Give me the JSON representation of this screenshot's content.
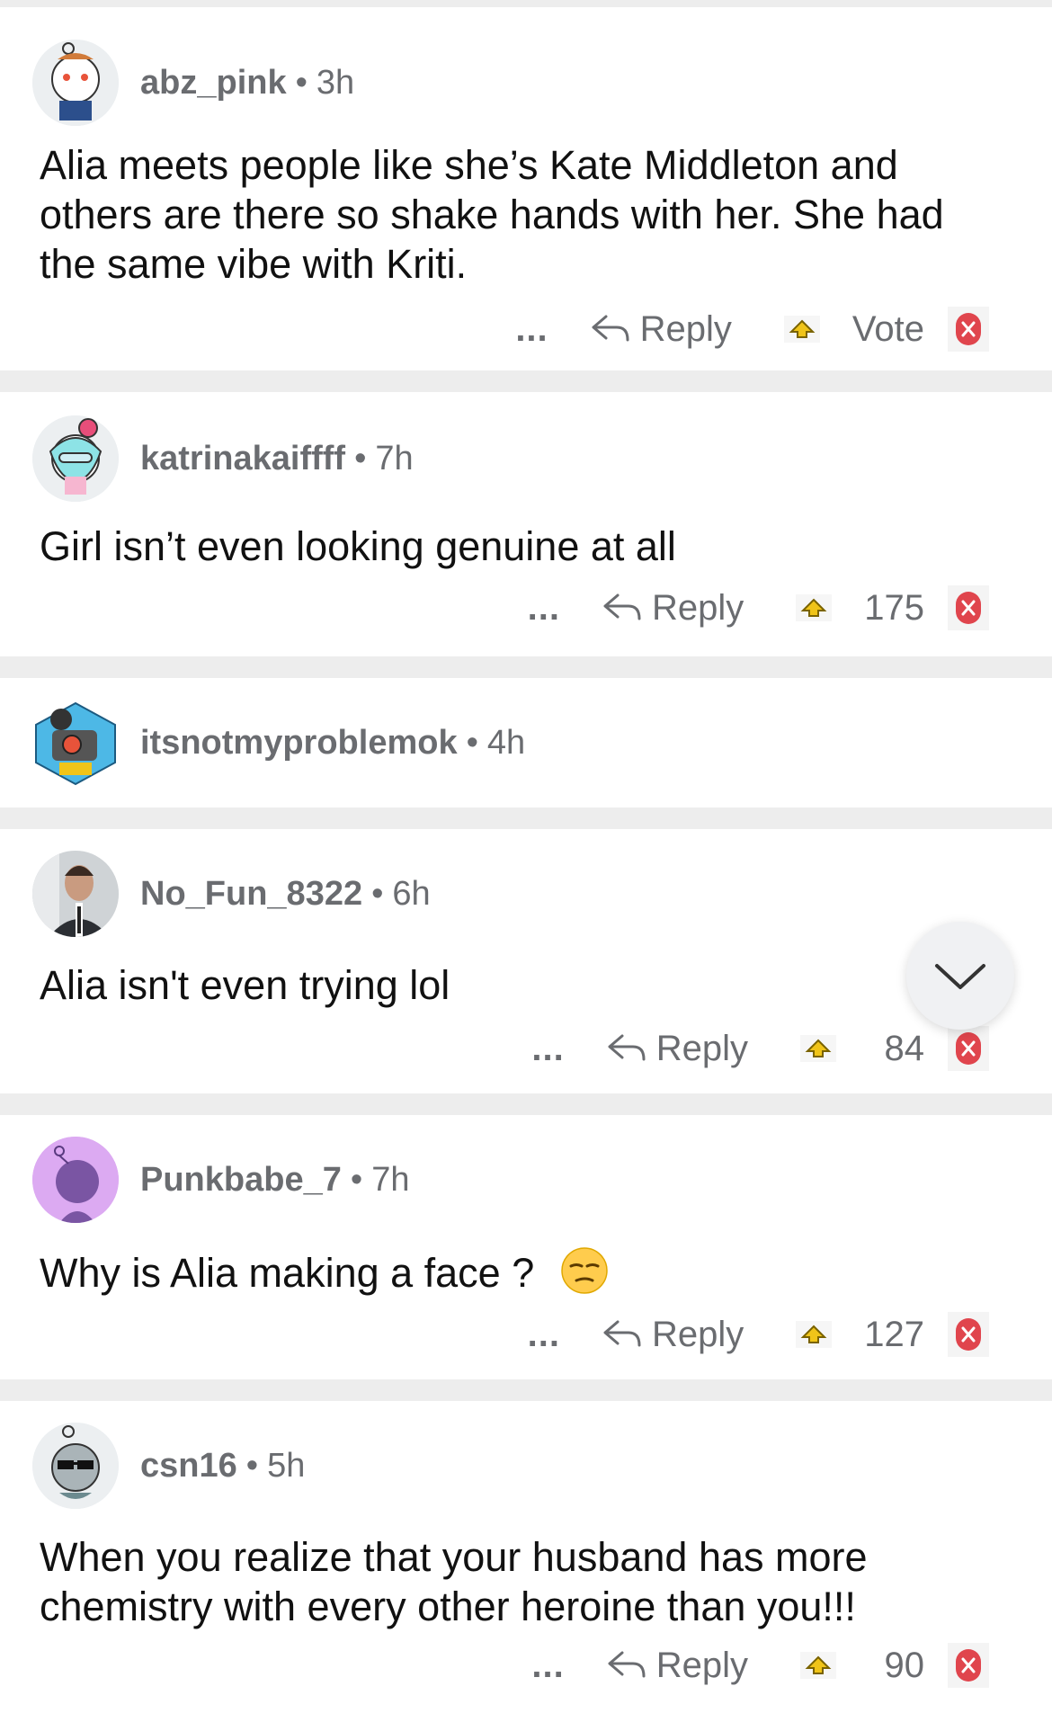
{
  "comments": [
    {
      "username": "abz_pink",
      "age": "3h",
      "text": "Alia meets people like she’s Kate Middleton and others are there so shake hands with her. She had the same vibe with Kriti.",
      "reply_label": "Reply",
      "score": "Vote",
      "more": "..."
    },
    {
      "username": "katrinakaiffff",
      "age": "7h",
      "text": "Girl isn’t even looking genuine at all",
      "reply_label": "Reply",
      "score": "175",
      "more": "..."
    },
    {
      "username": "itsnotmyproblemok",
      "age": "4h"
    },
    {
      "username": "No_Fun_8322",
      "age": "6h",
      "text": "Alia isn't even trying lol",
      "reply_label": "Reply",
      "score": "84",
      "more": "..."
    },
    {
      "username": "Punkbabe_7",
      "age": "7h",
      "text": "Why is Alia making a face ?",
      "reply_label": "Reply",
      "score": "127",
      "more": "..."
    },
    {
      "username": "csn16",
      "age": "5h",
      "text": "When you realize that your husband has more chemistry with every other heroine than you!!!",
      "reply_label": "Reply",
      "score": "90",
      "more": "..."
    }
  ],
  "separator": "•",
  "colors": {
    "background": "#ededed",
    "card": "#ffffff",
    "meta_text": "#6a6c70",
    "upvote": "#f0c419",
    "downvote": "#e0454d"
  },
  "icons": {
    "reply": "reply-arrow-icon",
    "upvote": "upvote-arrow-icon",
    "downvote": "downvote-x-icon",
    "scroll": "chevron-down-icon"
  }
}
